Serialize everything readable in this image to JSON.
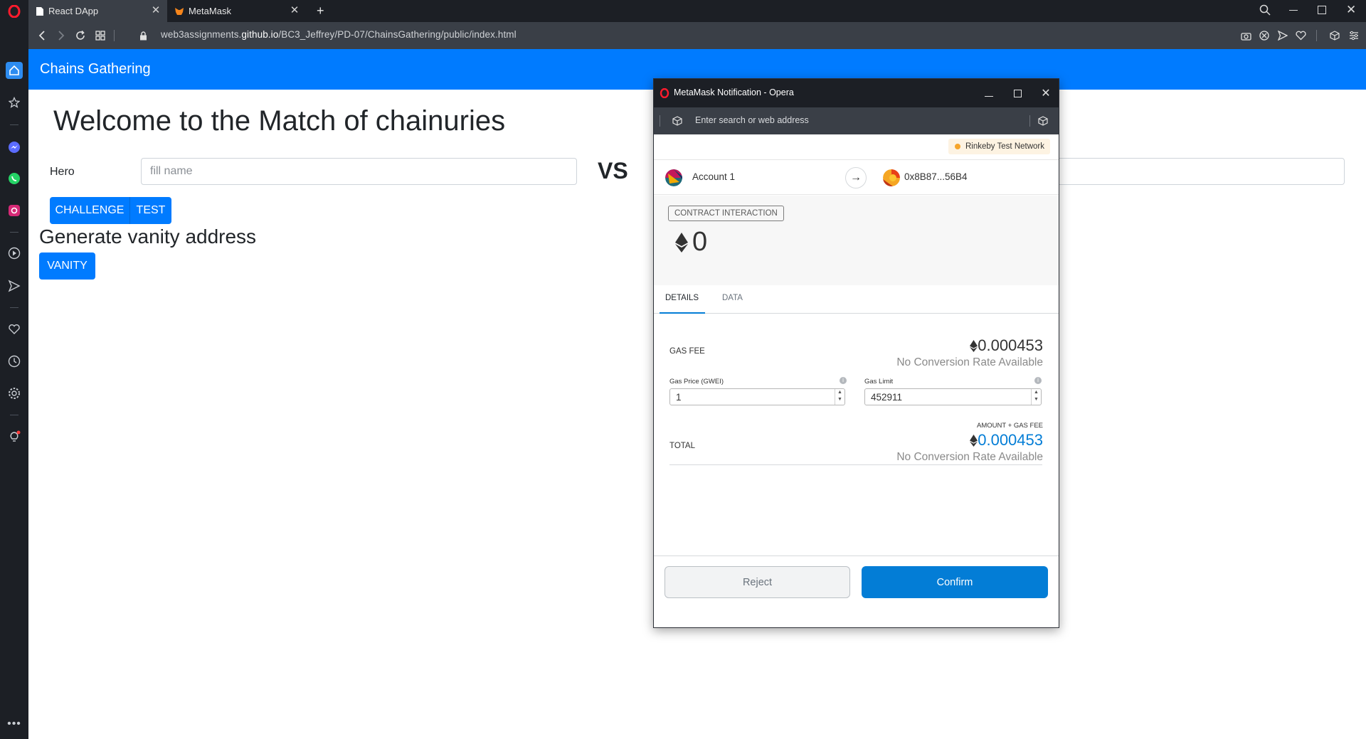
{
  "browser": {
    "tabs": [
      {
        "label": "React DApp",
        "icon": "document-icon",
        "active": true
      },
      {
        "label": "MetaMask",
        "icon": "metamask-fox-icon",
        "active": false
      }
    ],
    "url_prefix": "web3assignments.",
    "url_domain": "github.io",
    "url_path": "/BC3_Jeffrey/PD-07/ChainsGathering/public/index.html"
  },
  "app": {
    "brand": "Chains Gathering",
    "welcome": "Welcome to the Match of chainuries",
    "hero_label": "Hero",
    "hero_placeholder": "fill name",
    "vs": "VS",
    "challenge_label": "CHALLENGE",
    "test_label": "TEST",
    "vanity_title": "Generate vanity address",
    "vanity_label": "VANITY",
    "accent_color": "#007bff"
  },
  "popup": {
    "window_title": "MetaMask Notification - Opera",
    "address_placeholder": "Enter search or web address",
    "network": "Rinkeby Test Network",
    "from_account": "Account 1",
    "to_address": "0x8B87...56B4",
    "interaction_badge": "CONTRACT INTERACTION",
    "amount": "0",
    "tabs": {
      "details": "DETAILS",
      "data": "DATA"
    },
    "gas_fee_label": "GAS FEE",
    "gas_fee_value": "0.000453",
    "no_conversion": "No Conversion Rate Available",
    "gas_price_label": "Gas Price (GWEI)",
    "gas_price_value": "1",
    "gas_limit_label": "Gas Limit",
    "gas_limit_value": "452911",
    "amount_gas_label": "AMOUNT + GAS FEE",
    "total_label": "TOTAL",
    "total_value": "0.000453",
    "total_no_conversion": "No Conversion Rate Available",
    "reject_label": "Reject",
    "confirm_label": "Confirm",
    "confirm_color": "#037dd6"
  }
}
